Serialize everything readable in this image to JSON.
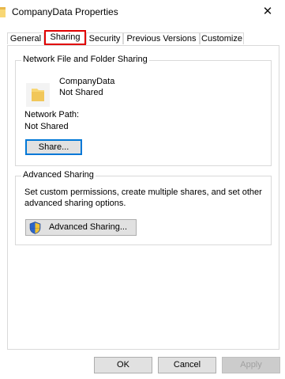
{
  "window": {
    "title": "CompanyData Properties",
    "close_glyph": "✕"
  },
  "tabs": [
    {
      "label": "General",
      "active": false
    },
    {
      "label": "Sharing",
      "active": true
    },
    {
      "label": "Security",
      "active": false
    },
    {
      "label": "Previous Versions",
      "active": false
    },
    {
      "label": "Customize",
      "active": false
    }
  ],
  "network_sharing": {
    "group_title": "Network File and Folder Sharing",
    "folder_name": "CompanyData",
    "folder_status": "Not Shared",
    "path_label": "Network Path:",
    "path_value": "Not Shared",
    "share_button": "Share..."
  },
  "advanced_sharing": {
    "group_title": "Advanced Sharing",
    "description_line1": "Set custom permissions, create multiple shares, and set other",
    "description_line2": "advanced sharing options.",
    "button_label": "Advanced Sharing..."
  },
  "footer": {
    "ok": "OK",
    "cancel": "Cancel",
    "apply": "Apply"
  },
  "colors": {
    "highlight_red": "#e00000",
    "focus_blue": "#0078d7",
    "folder_yellow": "#f8d775"
  },
  "icons": [
    "folder-icon",
    "close-icon",
    "shield-icon"
  ]
}
